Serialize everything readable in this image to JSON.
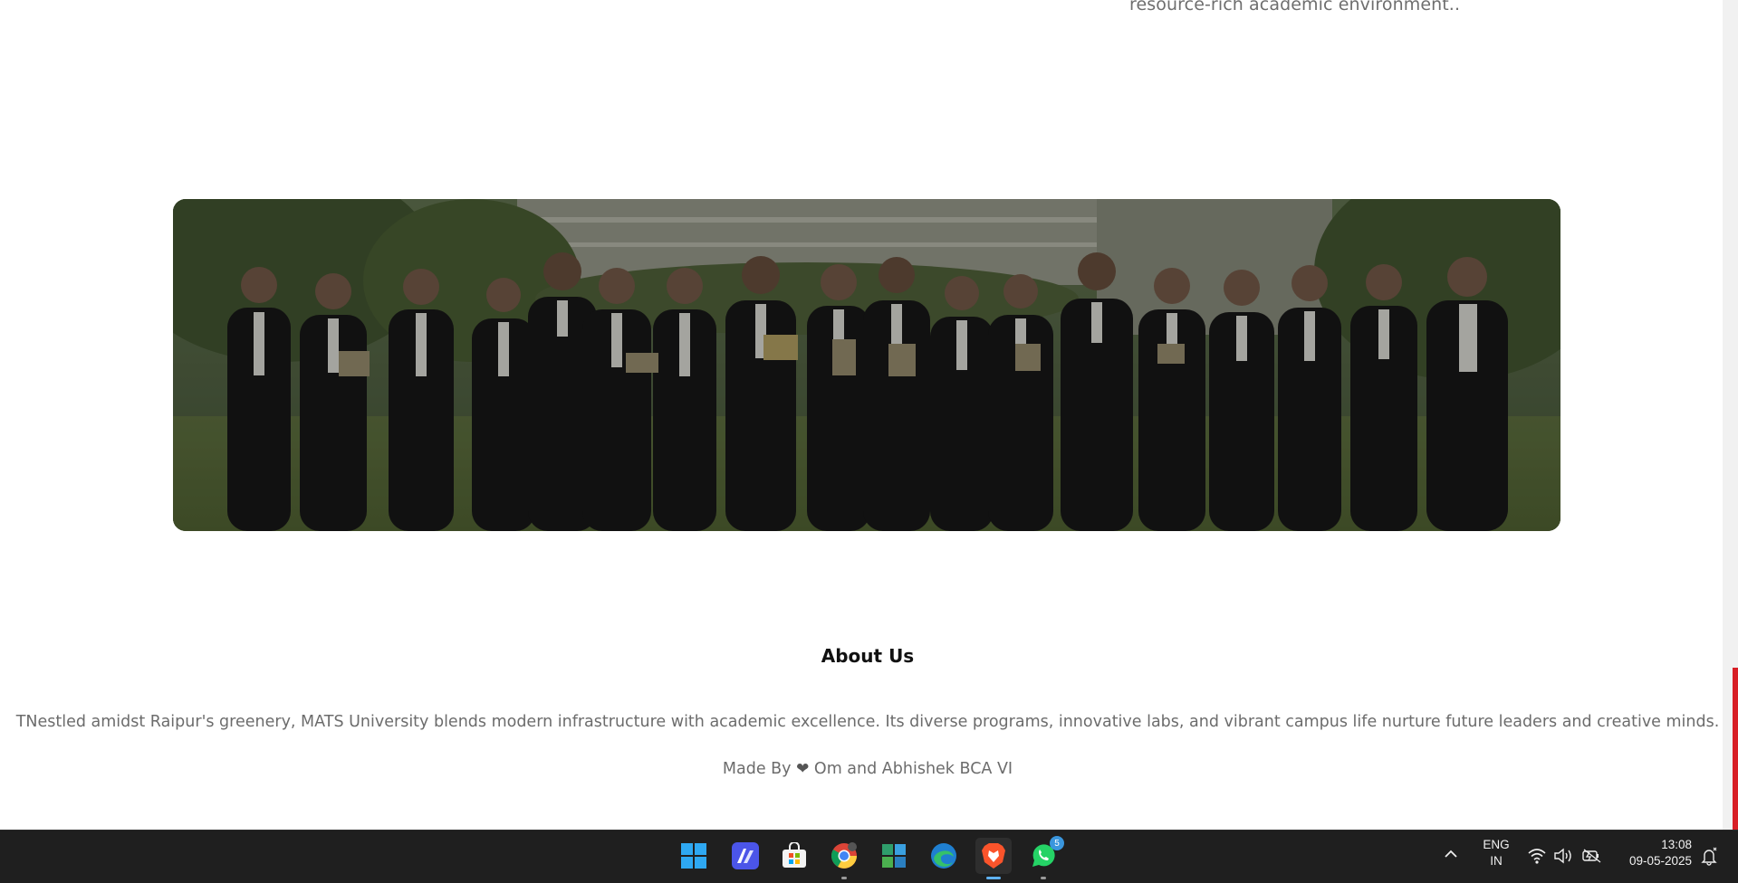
{
  "content": {
    "top_snippet": "resource-rich academic environment..",
    "about_title": "About Us",
    "about_text": "TNestled amidst Raipur's greenery, MATS University blends modern infrastructure with academic excellence. Its diverse programs, innovative labs, and vibrant campus life nurture future leaders and creative minds.",
    "made_by_prefix": "Made By",
    "made_by_heart": "❤",
    "made_by_suffix": "Om and Abhishek BCA VI"
  },
  "taskbar": {
    "apps": [
      {
        "name": "start-icon"
      },
      {
        "name": "maps-app-icon"
      },
      {
        "name": "microsoft-store-icon"
      },
      {
        "name": "chrome-icon"
      },
      {
        "name": "widgets-app-icon"
      },
      {
        "name": "edge-icon"
      },
      {
        "name": "brave-icon",
        "active": true
      },
      {
        "name": "whatsapp-icon",
        "badge": "5"
      }
    ],
    "lang_line1": "ENG",
    "lang_line2": "IN",
    "time": "13:08",
    "date": "09-05-2025"
  },
  "colors": {
    "accent_scroll": "#d81f26",
    "taskbar_bg": "#1f1f1f",
    "active_indicator": "#5fb2f2"
  }
}
